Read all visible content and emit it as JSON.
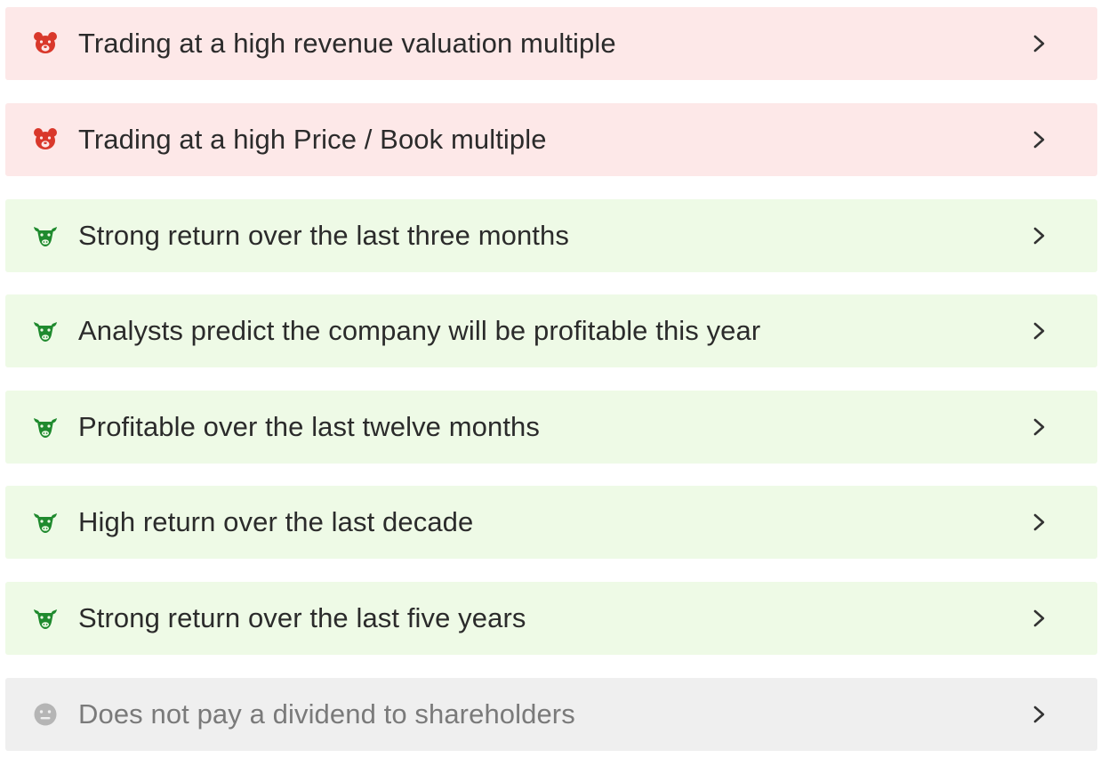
{
  "colors": {
    "bear_bg": "#fde8e8",
    "bear_icon": "#d9382b",
    "bull_bg": "#eefae6",
    "bull_icon": "#1f8a2e",
    "neutral_bg": "#efefef",
    "neutral_icon": "#b5b5b5",
    "text": "#2b2b2b",
    "neutral_text": "#7a7a7a",
    "chevron": "#333333"
  },
  "items": [
    {
      "type": "bear",
      "icon": "bear-icon",
      "label": "Trading at a high revenue valuation multiple"
    },
    {
      "type": "bear",
      "icon": "bear-icon",
      "label": "Trading at a high Price / Book multiple"
    },
    {
      "type": "bull",
      "icon": "bull-icon",
      "label": "Strong return over the last three months"
    },
    {
      "type": "bull",
      "icon": "bull-icon",
      "label": "Analysts predict the company will be profitable this year"
    },
    {
      "type": "bull",
      "icon": "bull-icon",
      "label": "Profitable over the last twelve months"
    },
    {
      "type": "bull",
      "icon": "bull-icon",
      "label": "High return over the last decade"
    },
    {
      "type": "bull",
      "icon": "bull-icon",
      "label": "Strong return over the last five years"
    },
    {
      "type": "neutral",
      "icon": "neutral-face-icon",
      "label": "Does not pay a dividend to shareholders"
    }
  ]
}
